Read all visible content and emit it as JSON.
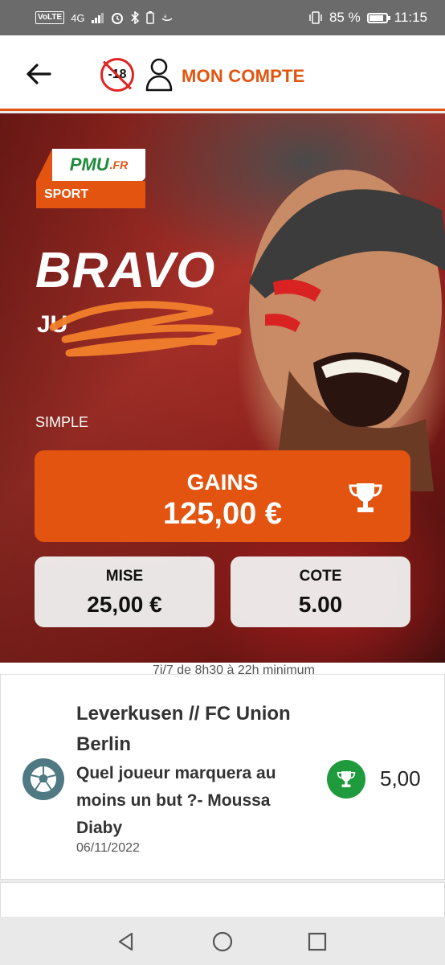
{
  "status_bar": {
    "network_badge": "VoLTE",
    "network_type": "4G",
    "battery_percent": "85 %",
    "time": "11:15"
  },
  "header": {
    "age_restriction": "-18",
    "account_label": "MON COMPTE",
    "accent_color": "#e2540f"
  },
  "hero": {
    "logo_brand": "PMU",
    "logo_domain": ".FR",
    "logo_section": "SPORT",
    "headline": "BRAVO",
    "user_name": "JU",
    "bet_type": "SIMPLE",
    "gains_label": "GAINS",
    "gains_value": "125,00 €",
    "mise_label": "MISE",
    "mise_value": "25,00 €",
    "cote_label": "COTE",
    "cote_value": "5.00"
  },
  "hours_note": "7j/7 de 8h30 à 22h minimum",
  "bet_card": {
    "match": "Leverkusen // FC Union Berlin",
    "question": "Quel joueur marquera au moins un but ?- Moussa Diaby",
    "date": "06/11/2022",
    "odds": "5,00",
    "sport_icon": "soccer-ball-icon",
    "status_icon": "trophy-icon",
    "status_color": "#1f9a3c"
  },
  "nav": {
    "back": "triangle-back-icon",
    "home": "circle-home-icon",
    "recent": "square-recent-icon"
  }
}
